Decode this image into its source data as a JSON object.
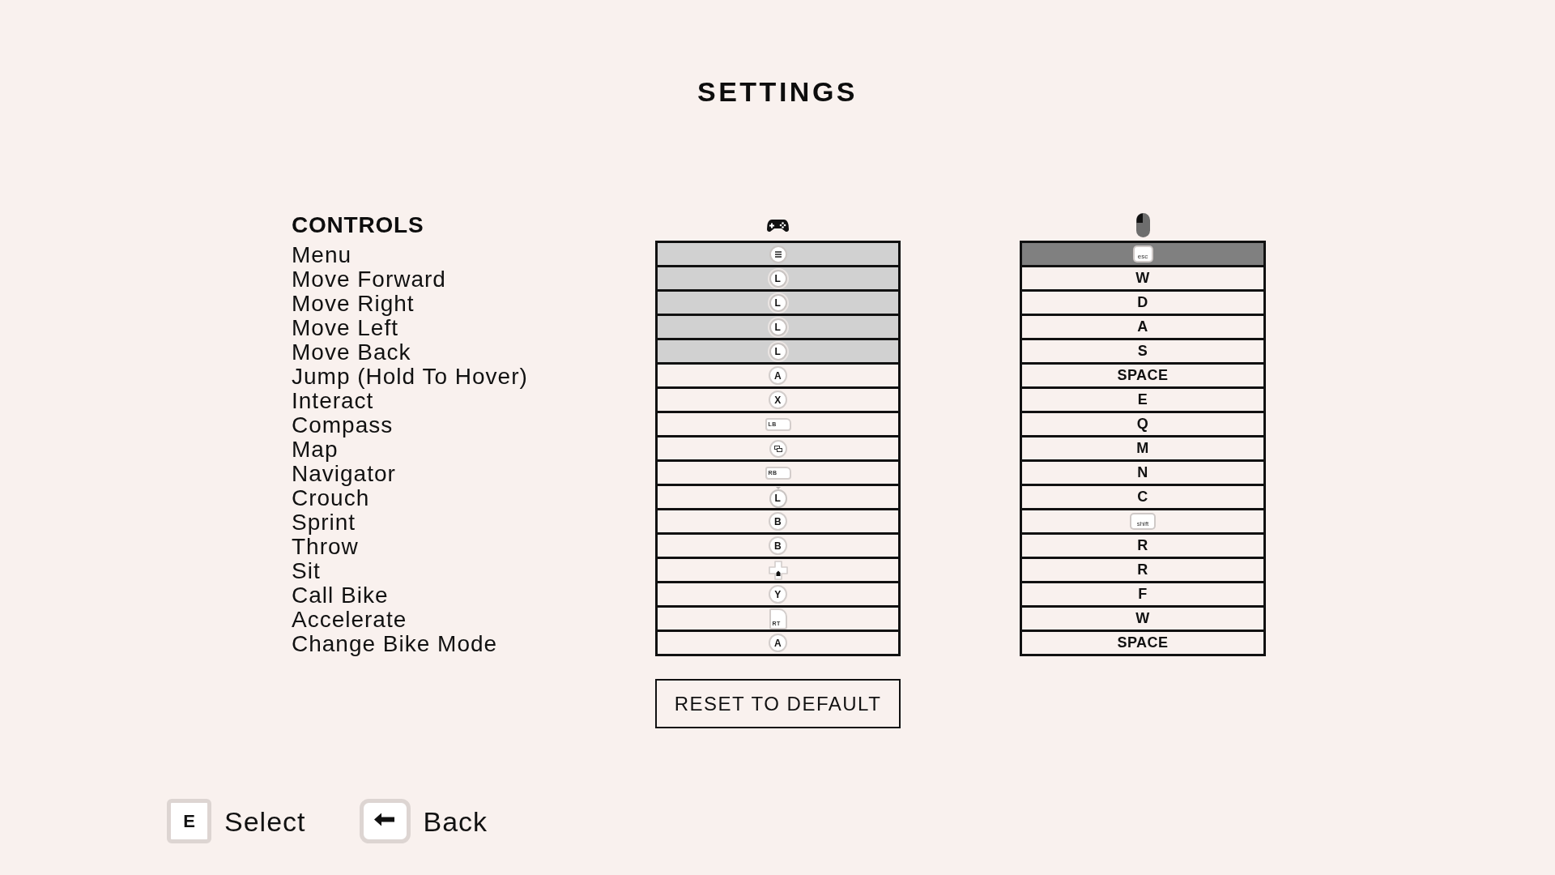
{
  "title": "SETTINGS",
  "section": {
    "title": "CONTROLS"
  },
  "rows": [
    {
      "action": "Menu",
      "gamepad": {
        "kind": "menu",
        "disabled": true
      },
      "keyboard": {
        "kind": "keycap",
        "label": "esc",
        "selected": true
      }
    },
    {
      "action": "Move Forward",
      "gamepad": {
        "kind": "stick",
        "label": "L",
        "disabled": true
      },
      "keyboard": {
        "kind": "letter",
        "label": "W",
        "selected": false
      }
    },
    {
      "action": "Move Right",
      "gamepad": {
        "kind": "stick",
        "label": "L",
        "disabled": true
      },
      "keyboard": {
        "kind": "letter",
        "label": "D",
        "selected": false
      }
    },
    {
      "action": "Move Left",
      "gamepad": {
        "kind": "stick",
        "label": "L",
        "disabled": true
      },
      "keyboard": {
        "kind": "letter",
        "label": "A",
        "selected": false
      }
    },
    {
      "action": "Move Back",
      "gamepad": {
        "kind": "stick",
        "label": "L",
        "disabled": true
      },
      "keyboard": {
        "kind": "letter",
        "label": "S",
        "selected": false
      }
    },
    {
      "action": "Jump (Hold To Hover)",
      "gamepad": {
        "kind": "face",
        "label": "A",
        "disabled": false
      },
      "keyboard": {
        "kind": "letter",
        "label": "SPACE",
        "selected": false
      }
    },
    {
      "action": "Interact",
      "gamepad": {
        "kind": "face",
        "label": "X",
        "disabled": false
      },
      "keyboard": {
        "kind": "letter",
        "label": "E",
        "selected": false
      }
    },
    {
      "action": "Compass",
      "gamepad": {
        "kind": "bumper",
        "label": "LB",
        "disabled": false
      },
      "keyboard": {
        "kind": "letter",
        "label": "Q",
        "selected": false
      }
    },
    {
      "action": "Map",
      "gamepad": {
        "kind": "view",
        "disabled": false
      },
      "keyboard": {
        "kind": "letter",
        "label": "M",
        "selected": false
      }
    },
    {
      "action": "Navigator",
      "gamepad": {
        "kind": "bumper",
        "label": "RB",
        "disabled": false
      },
      "keyboard": {
        "kind": "letter",
        "label": "N",
        "selected": false
      }
    },
    {
      "action": "Crouch",
      "gamepad": {
        "kind": "stick-press",
        "label": "L",
        "disabled": false
      },
      "keyboard": {
        "kind": "letter",
        "label": "C",
        "selected": false
      }
    },
    {
      "action": "Sprint",
      "gamepad": {
        "kind": "face",
        "label": "B",
        "disabled": false
      },
      "keyboard": {
        "kind": "keycap",
        "label": "shift",
        "selected": false
      }
    },
    {
      "action": "Throw",
      "gamepad": {
        "kind": "face",
        "label": "B",
        "disabled": false
      },
      "keyboard": {
        "kind": "letter",
        "label": "R",
        "selected": false
      }
    },
    {
      "action": "Sit",
      "gamepad": {
        "kind": "dpad",
        "disabled": false
      },
      "keyboard": {
        "kind": "letter",
        "label": "R",
        "selected": false
      }
    },
    {
      "action": "Call Bike",
      "gamepad": {
        "kind": "face",
        "label": "Y",
        "disabled": false
      },
      "keyboard": {
        "kind": "letter",
        "label": "F",
        "selected": false
      }
    },
    {
      "action": "Accelerate",
      "gamepad": {
        "kind": "trigger",
        "label": "RT",
        "disabled": false
      },
      "keyboard": {
        "kind": "letter",
        "label": "W",
        "selected": false
      }
    },
    {
      "action": "Change Bike Mode",
      "gamepad": {
        "kind": "face",
        "label": "A",
        "disabled": false
      },
      "keyboard": {
        "kind": "letter",
        "label": "SPACE",
        "selected": false
      }
    }
  ],
  "reset_button": "RESET TO DEFAULT",
  "hints": [
    {
      "kind": "letter",
      "key": "E",
      "label": "Select"
    },
    {
      "kind": "arrow",
      "label": "Back"
    }
  ]
}
